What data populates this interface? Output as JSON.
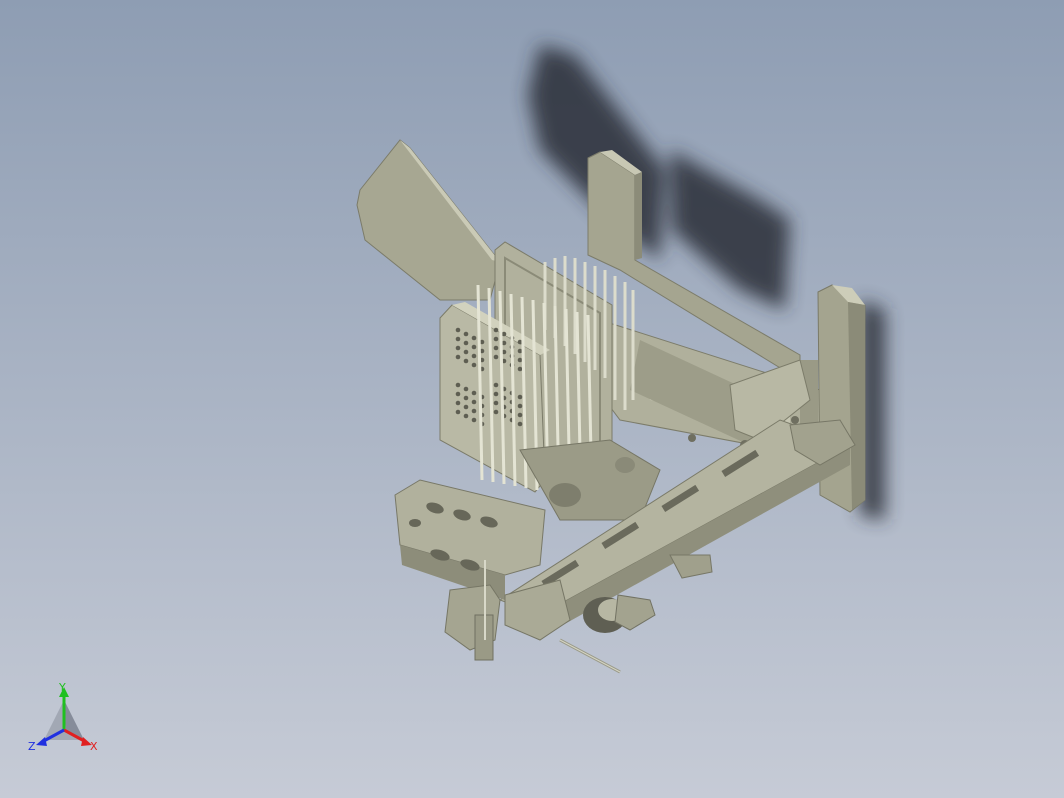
{
  "viewport": {
    "background_top": "#8e9db3",
    "background_bottom": "#c6cbd6"
  },
  "model": {
    "part_color": "#a9a994",
    "part_shade": "#8a8a77",
    "part_dark": "#6e6e5f",
    "part_light": "#c9c9b6",
    "shadow_color": "#2a2f38"
  },
  "triad": {
    "x_label": "X",
    "y_label": "Y",
    "z_label": "Z",
    "x_color": "#e02020",
    "y_color": "#20c020",
    "z_color": "#2030e0"
  }
}
